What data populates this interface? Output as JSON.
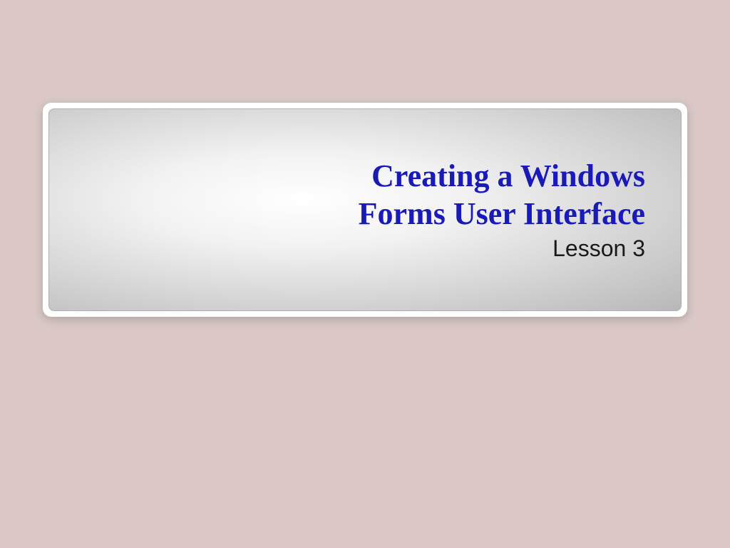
{
  "slide": {
    "title_line1": "Creating a Windows",
    "title_line2": "Forms User Interface",
    "subtitle": "Lesson 3"
  }
}
